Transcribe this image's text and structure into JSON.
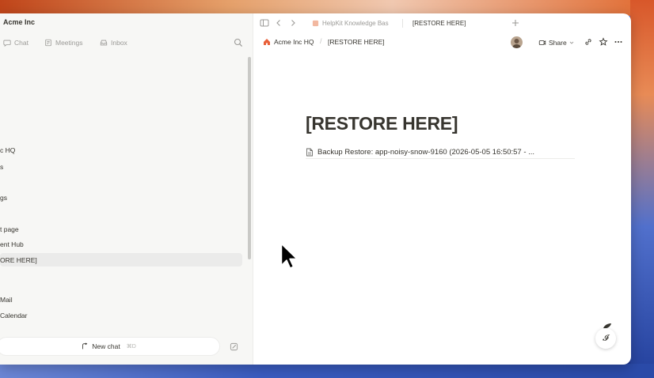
{
  "workspace": {
    "name": "Acme Inc"
  },
  "nav": {
    "chat": "Chat",
    "meetings": "Meetings",
    "inbox": "Inbox"
  },
  "sidebar": {
    "items": [
      {
        "label": "c HQ"
      },
      {
        "label": "s"
      },
      {
        "label": "gs"
      },
      {
        "label": "t page"
      },
      {
        "label": "ent Hub"
      },
      {
        "label": "ORE HERE]"
      },
      {
        "label": "Mail"
      },
      {
        "label": "Calendar"
      }
    ],
    "new_chat": {
      "label": "New chat",
      "shortcut": "⌘D"
    }
  },
  "tabs": [
    {
      "label": "HelpKit Knowledge Bas"
    },
    {
      "label": "[RESTORE HERE]"
    }
  ],
  "breadcrumb": {
    "workspace": "Acme Inc HQ",
    "page": "[RESTORE HERE]"
  },
  "topbar": {
    "share_label": "Share"
  },
  "page": {
    "title": "[RESTORE HERE]",
    "subpage": "Backup Restore: app-noisy-snow-9160 (2026-05-05 16:50:57 - ..."
  },
  "colors": {
    "text": "#37352f",
    "muted": "#9b9a97",
    "sidebar_bg": "#f7f7f5",
    "brand_orange": "#e8613a"
  }
}
